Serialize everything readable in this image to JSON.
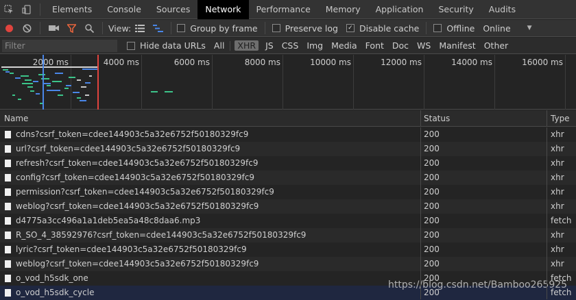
{
  "tabs": [
    "Elements",
    "Console",
    "Sources",
    "Network",
    "Performance",
    "Memory",
    "Application",
    "Security",
    "Audits"
  ],
  "active_tab": "Network",
  "toolbar": {
    "view_label": "View:",
    "group_by_frame": "Group by frame",
    "preserve_log": "Preserve log",
    "disable_cache": "Disable cache",
    "offline": "Offline",
    "throttle": "Online"
  },
  "filter": {
    "placeholder": "Filter",
    "hide_data_urls": "Hide data URLs",
    "types": [
      "All",
      "XHR",
      "JS",
      "CSS",
      "Img",
      "Media",
      "Font",
      "Doc",
      "WS",
      "Manifest",
      "Other"
    ],
    "active_type": "XHR"
  },
  "timeline": {
    "ticks": [
      "2000 ms",
      "4000 ms",
      "6000 ms",
      "8000 ms",
      "10000 ms",
      "12000 ms",
      "14000 ms",
      "16000 ms"
    ]
  },
  "table": {
    "headers": {
      "name": "Name",
      "status": "Status",
      "type": "Type"
    },
    "rows": [
      {
        "name": "cdns?csrf_token=cdee144903c5a32e6752f50180329fc9",
        "status": "200",
        "type": "xhr"
      },
      {
        "name": "url?csrf_token=cdee144903c5a32e6752f50180329fc9",
        "status": "200",
        "type": "xhr"
      },
      {
        "name": "refresh?csrf_token=cdee144903c5a32e6752f50180329fc9",
        "status": "200",
        "type": "xhr"
      },
      {
        "name": "config?csrf_token=cdee144903c5a32e6752f50180329fc9",
        "status": "200",
        "type": "xhr"
      },
      {
        "name": "permission?csrf_token=cdee144903c5a32e6752f50180329fc9",
        "status": "200",
        "type": "xhr"
      },
      {
        "name": "weblog?csrf_token=cdee144903c5a32e6752f50180329fc9",
        "status": "200",
        "type": "xhr"
      },
      {
        "name": "d4775a3cc496a1a1deb5ea5a48c8daa6.mp3",
        "status": "200",
        "type": "fetch"
      },
      {
        "name": "R_SO_4_38592976?csrf_token=cdee144903c5a32e6752f50180329fc9",
        "status": "200",
        "type": "xhr"
      },
      {
        "name": "lyric?csrf_token=cdee144903c5a32e6752f50180329fc9",
        "status": "200",
        "type": "xhr"
      },
      {
        "name": "weblog?csrf_token=cdee144903c5a32e6752f50180329fc9",
        "status": "200",
        "type": "xhr"
      },
      {
        "name": "o_vod_h5sdk_one",
        "status": "200",
        "type": "fetch"
      },
      {
        "name": "o_vod_h5sdk_cycle",
        "status": "200",
        "type": "fetch"
      }
    ]
  },
  "watermark": "https://blog.csdn.net/Bamboo265925",
  "colors": {
    "record": "#e0443e",
    "filter_icon": "#e8643c",
    "waterfall_blue": "#4a86e8",
    "waterfall_green": "#3cc48a"
  }
}
